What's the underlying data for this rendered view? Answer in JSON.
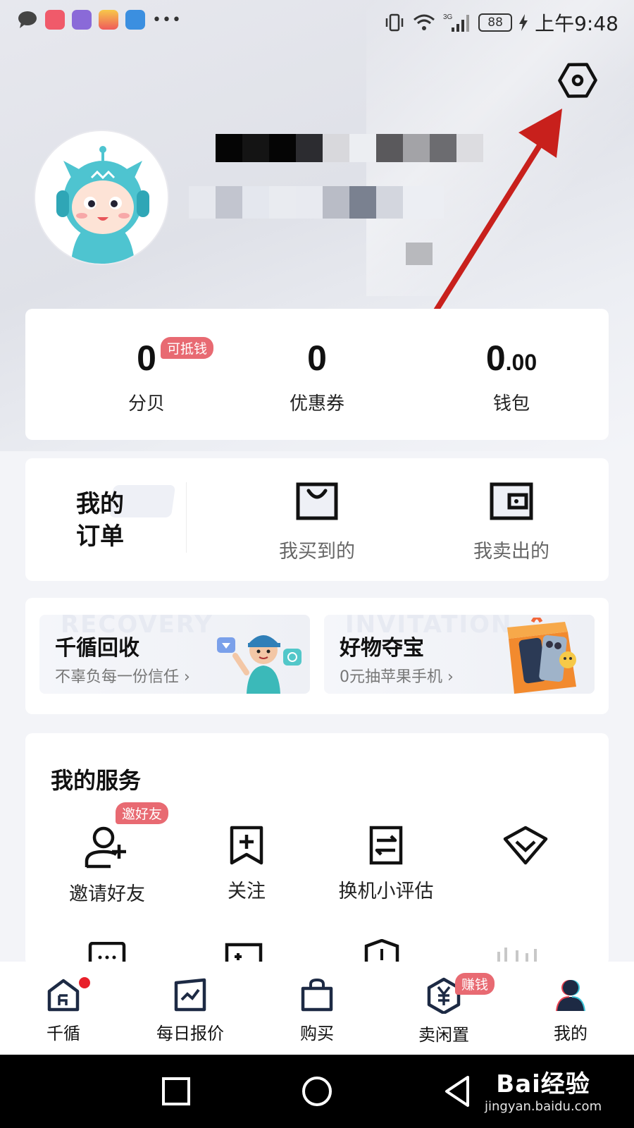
{
  "status_bar": {
    "time": "上午9:48",
    "battery": "88",
    "network": "3G"
  },
  "profile": {
    "settings_icon": "gear-icon"
  },
  "stats": {
    "fenbei": {
      "value": "0",
      "label": "分贝",
      "badge": "可抵钱"
    },
    "coupons": {
      "value": "0",
      "label": "优惠券"
    },
    "wallet": {
      "value_int": "0",
      "value_dec": ".00",
      "label": "钱包"
    }
  },
  "orders": {
    "title_line1": "我的",
    "title_line2": "订单",
    "bought": "我买到的",
    "sold": "我卖出的"
  },
  "promos": [
    {
      "title": "千循回收",
      "subtitle": "不辜负每一份信任",
      "bg_word": "RECOVERY"
    },
    {
      "title": "好物夺宝",
      "subtitle": "0元抽苹果手机",
      "bg_word": "INVITATION"
    }
  ],
  "services": {
    "title": "我的服务",
    "items": [
      {
        "label": "邀请好友",
        "badge": "邀好友"
      },
      {
        "label": "关注"
      },
      {
        "label": "换机小评估"
      },
      {
        "label": ""
      }
    ]
  },
  "bottom_nav": {
    "items": [
      {
        "label": "千循"
      },
      {
        "label": "每日报价"
      },
      {
        "label": "购买"
      },
      {
        "label": "卖闲置",
        "badge": "赚钱"
      },
      {
        "label": "我的"
      }
    ]
  },
  "watermark": {
    "main": "Bai经验",
    "sub": "jingyan.baidu.com"
  },
  "colors": {
    "accent_red": "#e86a72",
    "arrow_red": "#c8201c"
  }
}
